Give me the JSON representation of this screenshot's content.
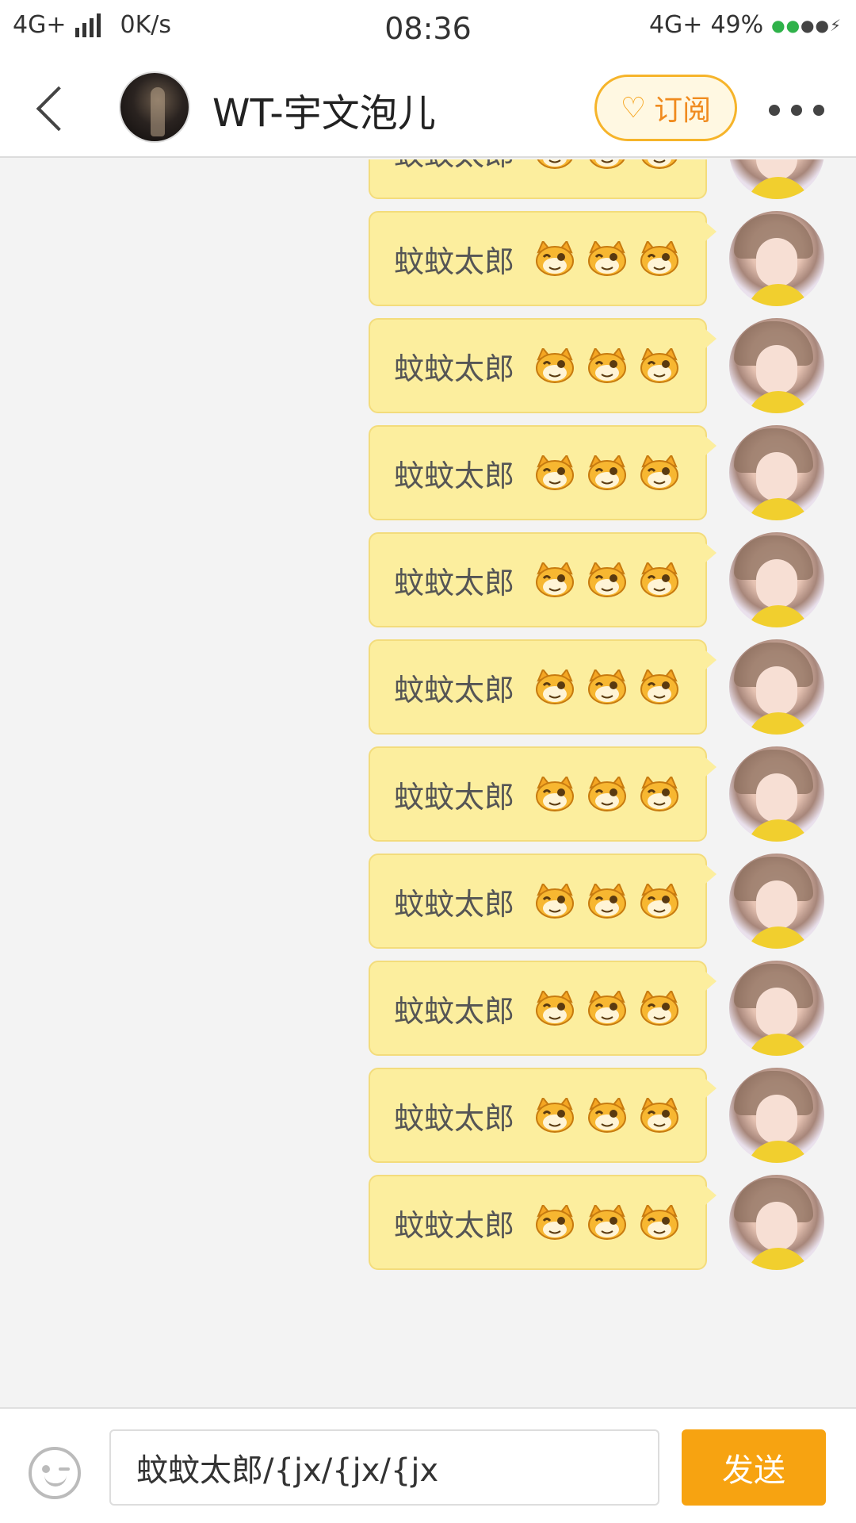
{
  "status_bar": {
    "network_left": "4G+",
    "speed": "0K/s",
    "time": "08:36",
    "network_right": "4G+",
    "battery": "49%",
    "battery_icon": "paw-battery-icon"
  },
  "header": {
    "title": "WT-宇文泡儿",
    "subscribe_label": "订阅",
    "subscribe_icon": "heart-plus-icon",
    "back_icon": "chevron-left-icon",
    "more_icon": "more-dots-icon",
    "accent_color": "#f6b42a"
  },
  "messages": [
    {
      "text": "蚊蚊太郎",
      "emoji": [
        "tiger-face-emoji",
        "tiger-face-emoji",
        "tiger-face-emoji"
      ]
    },
    {
      "text": "蚊蚊太郎",
      "emoji": [
        "tiger-face-emoji",
        "tiger-face-emoji",
        "tiger-face-emoji"
      ]
    },
    {
      "text": "蚊蚊太郎",
      "emoji": [
        "tiger-face-emoji",
        "tiger-face-emoji",
        "tiger-face-emoji"
      ]
    },
    {
      "text": "蚊蚊太郎",
      "emoji": [
        "tiger-face-emoji",
        "tiger-face-emoji",
        "tiger-face-emoji"
      ]
    },
    {
      "text": "蚊蚊太郎",
      "emoji": [
        "tiger-face-emoji",
        "tiger-face-emoji",
        "tiger-face-emoji"
      ]
    },
    {
      "text": "蚊蚊太郎",
      "emoji": [
        "tiger-face-emoji",
        "tiger-face-emoji",
        "tiger-face-emoji"
      ]
    },
    {
      "text": "蚊蚊太郎",
      "emoji": [
        "tiger-face-emoji",
        "tiger-face-emoji",
        "tiger-face-emoji"
      ]
    },
    {
      "text": "蚊蚊太郎",
      "emoji": [
        "tiger-face-emoji",
        "tiger-face-emoji",
        "tiger-face-emoji"
      ]
    },
    {
      "text": "蚊蚊太郎",
      "emoji": [
        "tiger-face-emoji",
        "tiger-face-emoji",
        "tiger-face-emoji"
      ]
    },
    {
      "text": "蚊蚊太郎",
      "emoji": [
        "tiger-face-emoji",
        "tiger-face-emoji",
        "tiger-face-emoji"
      ]
    },
    {
      "text": "蚊蚊太郎",
      "emoji": [
        "tiger-face-emoji",
        "tiger-face-emoji",
        "tiger-face-emoji"
      ]
    }
  ],
  "input_bar": {
    "value": "蚊蚊太郎/{jx/{jx/{jx",
    "send_label": "发送",
    "emoji_icon": "smiley-face-icon",
    "send_color": "#f7a311"
  },
  "colors": {
    "bubble": "#fcee9e",
    "background": "#f3f3f3"
  }
}
